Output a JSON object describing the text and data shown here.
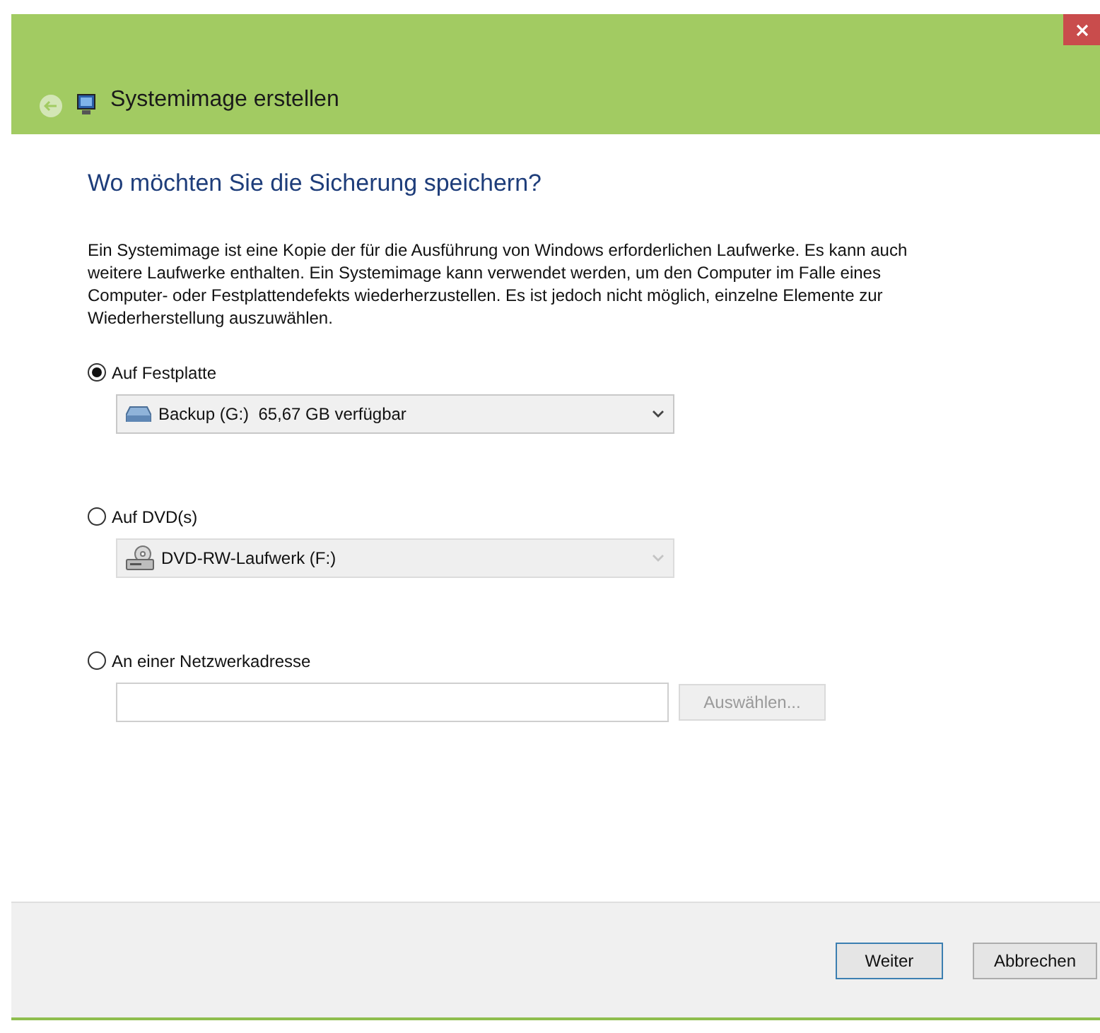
{
  "window": {
    "title": "Systemimage erstellen"
  },
  "heading": "Wo möchten Sie die Sicherung speichern?",
  "description": "Ein Systemimage ist eine Kopie der für die Ausführung von Windows erforderlichen Laufwerke. Es kann auch weitere Laufwerke enthalten. Ein Systemimage kann verwendet werden, um den Computer im Falle eines Computer- oder Festplattendefekts wiederherzustellen. Es ist jedoch nicht möglich, einzelne Elemente zur Wiederherstellung auszuwählen.",
  "options": [
    {
      "kind": "drive",
      "label": "Auf Festplatte",
      "selected": true,
      "dropdown": {
        "value": "Backup (G:)  65,67 GB verfügbar",
        "kind": "disk",
        "disabled": false
      }
    },
    {
      "kind": "drive",
      "label": "Auf DVD(s)",
      "selected": false,
      "dropdown": {
        "value": "DVD-RW-Laufwerk (F:)",
        "kind": "dvd",
        "disabled": true
      }
    },
    {
      "kind": "network",
      "label": "An einer Netzwerkadresse",
      "selected": false,
      "button": {
        "label": "Auswählen...",
        "disabled": true
      }
    }
  ],
  "buttons": [
    {
      "label": "Weiter",
      "default": true
    },
    {
      "label": "Abbrechen",
      "default": false
    }
  ]
}
